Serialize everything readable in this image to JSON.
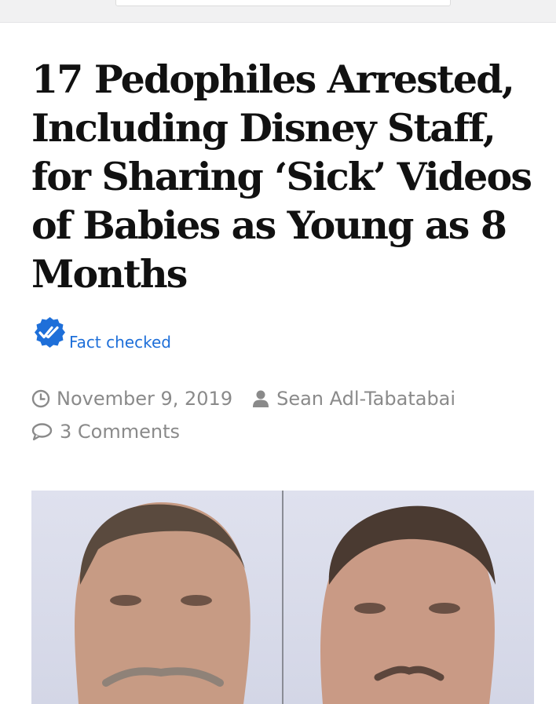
{
  "article": {
    "title": "17 Pedophiles Arrested, Including Disney Staff, for Sharing ‘Sick’ Videos of Babies as Young as 8 Months",
    "fact_check_label": "Fact checked",
    "date": "November 9, 2019",
    "author": "Sean Adl-Tabatabai",
    "comments": "3 Comments"
  },
  "icons": {
    "fact_check": "double-check-badge-icon",
    "date": "clock-icon",
    "author": "user-icon",
    "comments": "comment-bubble-icon"
  },
  "colors": {
    "accent": "#1e6fd9",
    "meta_text": "#8a8a8a",
    "title_text": "#111111"
  }
}
